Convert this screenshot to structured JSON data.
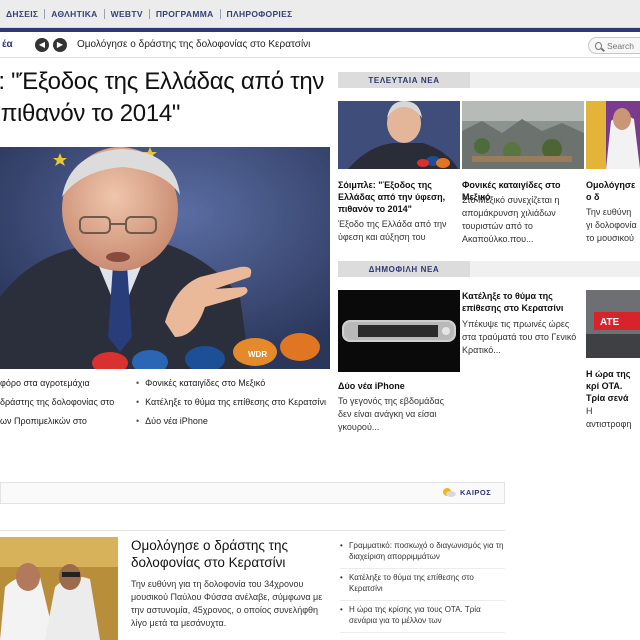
{
  "topnav": [
    "ΔΗΣΕΙΣ",
    "ΑΘΛΗΤΙΚΑ",
    "WEBTV",
    "ΠΡΟΓΡΑΜΜΑ",
    "ΠΛΗΡΟΦΟΡΙΕΣ"
  ],
  "ticker": {
    "label": "έα",
    "headline": "Ομολόγησε ο δράστης της δολοφονίας στο Κερατσίνι"
  },
  "search": {
    "placeholder": "Search"
  },
  "main_story": {
    "title_line1": "ε: \"Έξοδος της Ελλάδας από την",
    "title_line2": ", πιθανόν το 2014\""
  },
  "left_links": [
    "φόρο στα αγροτεμάχια",
    "δράστης της δολοφονίας στο",
    "",
    "ων Προπιμελικών στο",
    ""
  ],
  "mid_links": [
    "Φονικές καταιγίδες στο Μεξικό",
    "Κατέληξε το θύμα της επίθεσης στο Κερατσίνι",
    "Δύο νέα iPhone"
  ],
  "latest": {
    "tab": "ΤΕΛΕΥΤΑΙΑ ΝΕΑ",
    "items": [
      {
        "title": "Σόιμπλε: \"Έξοδος της Ελλάδας από την ύφεση, πιθανόν το 2014\"",
        "desc": "Έξοδο της Ελλάδα από την ύφεση και αύξηση του"
      },
      {
        "title": "Φονικές καταιγίδες στο Μεξικό",
        "desc": "Στο Μεξικό συνεχίζεται η απομάκρυνση χιλιάδων τουριστών από το Ακαπούλκο.που..."
      },
      {
        "title": "Ομολόγησε ο δ δολοφονίας σ",
        "desc": "Την ευθύνη γι δολοφονία το μουσικού Παύ"
      }
    ]
  },
  "popular": {
    "tab": "ΔΗΜΟΦΙΛΗ ΝΕΑ",
    "items": [
      {
        "title": "Δύο νέα iPhone",
        "desc": "Το γεγονός της εβδομάδας δεν είναι ανάγκη να είσαι γκουρού..."
      },
      {
        "title": "Κατέληξε το θύμα της επίθεσης στο Κερατσίνι",
        "desc": "Υπέκυψε τις πρωινές ώρες στα τραύματά του στο Γενικό Κρατικό..."
      },
      {
        "title": "Η ώρα της κρί ΟΤΑ. Τρία σενά μελλον των ο",
        "desc": "Η αντιστροφη την άφιξη της"
      }
    ],
    "banner_text": "ΑΤΕ"
  },
  "weather": {
    "label": "ΚΑΙΡΟΣ"
  },
  "featured": {
    "title": "Ομολόγησε ο δράστης της δολοφονίας στο Κερατσίνι",
    "desc": "Την ευθύνη για τη δολοφονία του 34χρονου μουσικού Παύλου Φύσσα ανέλαβε, σύμφωνα με την αστυνομία, 45χρονος, ο οποίος συνελήφθη λίγο μετά τα μεσάνυχτα."
  },
  "side_links": [
    "Γραμματικό: ποσκωχό ο διαγωνισμός για τη διαχείριση απορριμμάτων",
    "Κατέληξε το θύμα της επίθεσης στο Κερατσίνι",
    "Η ώρα της κρίσης για τους ΟΤΑ. Τρία σενάρια για το μέλλον των"
  ],
  "colors": {
    "nav_text": "#36427a",
    "nav_stripe": "#2e3773",
    "section_tab": "#dcdcdc"
  }
}
